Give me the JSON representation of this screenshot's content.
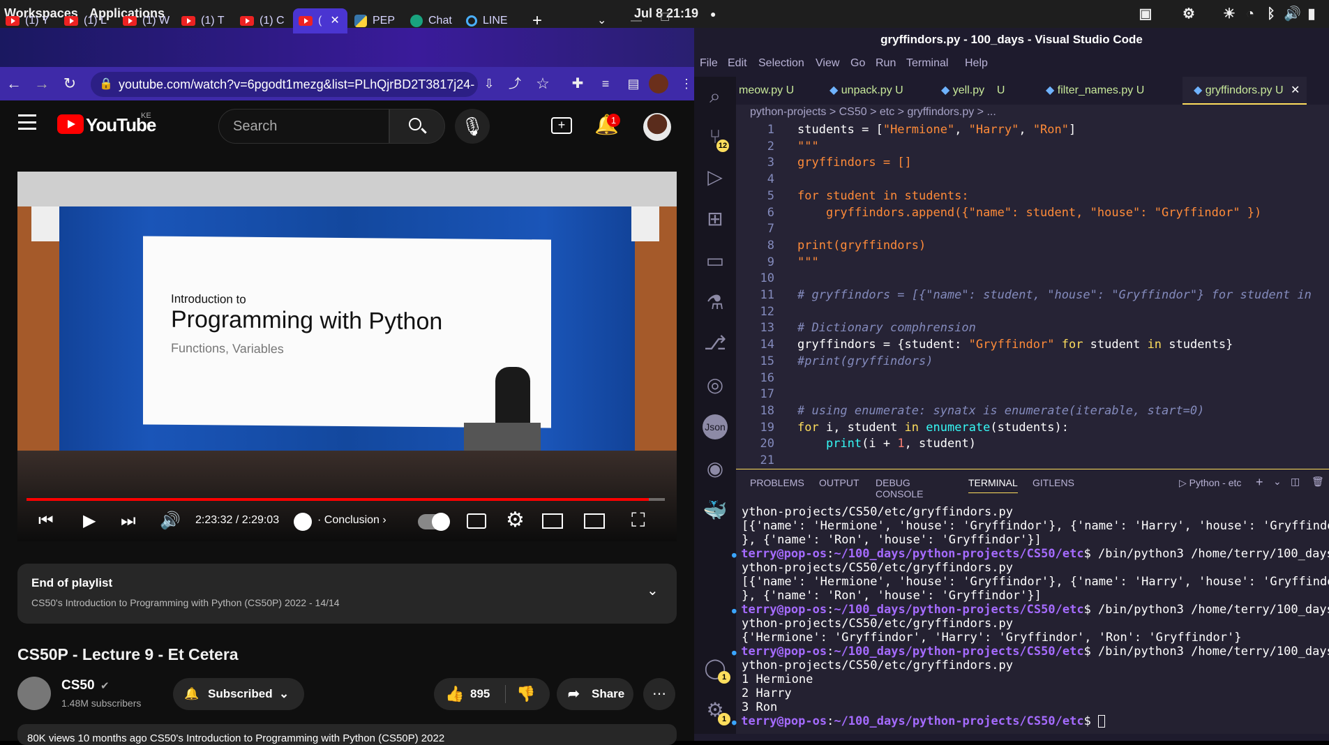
{
  "topbar": {
    "workspaces": "Workspaces",
    "applications": "Applications",
    "date": "Jul 8",
    "time": "21:19"
  },
  "chrome": {
    "tabs": [
      {
        "label": "(1) Y",
        "icon": "youtube-icon"
      },
      {
        "label": "(1) L",
        "icon": "youtube-icon"
      },
      {
        "label": "(1) W",
        "icon": "youtube-icon"
      },
      {
        "label": "(1) T",
        "icon": "youtube-icon"
      },
      {
        "label": "(1) C",
        "icon": "youtube-icon"
      },
      {
        "label": "(",
        "icon": "youtube-icon"
      },
      {
        "label": "PEP",
        "icon": "python-icon"
      },
      {
        "label": "Chat",
        "icon": "chatgpt-icon"
      },
      {
        "label": "LINE",
        "icon": "line-icon"
      }
    ],
    "url": "youtube.com/watch?v=6pgodt1mezg&list=PLhQjrBD2T3817j24-"
  },
  "youtube": {
    "logo": "YouTube",
    "country": "KE",
    "search_placeholder": "Search",
    "notifications": "1",
    "slide": {
      "intro": "Introduction to",
      "title": "Programming with Python",
      "subtitle": "Functions, Variables"
    },
    "progress": 0.975,
    "time": "2:23:32 / 2:29:03",
    "chapter": "Conclusion",
    "playlist": {
      "title": "End of playlist",
      "subtitle": "CS50's Introduction to Programming with Python (CS50P) 2022 - 14/14"
    },
    "video_title": "CS50P - Lecture 9 - Et Cetera",
    "channel": {
      "name": "CS50",
      "subs": "1.48M subscribers",
      "subscribe": "Subscribed"
    },
    "likes": "895",
    "share": "Share",
    "desc": "80K views  10 months ago  CS50's Introduction to Programming with Python (CS50P) 2022"
  },
  "vscode": {
    "title": "gryffindors.py - 100_days - Visual Studio Code",
    "menu": [
      "File",
      "Edit",
      "Selection",
      "View",
      "Go",
      "Run",
      "Terminal",
      "Help"
    ],
    "tabs": [
      {
        "label": "meow.py",
        "status": "U"
      },
      {
        "label": "unpack.py",
        "status": "U"
      },
      {
        "label": "yell.py",
        "status": "U"
      },
      {
        "label": "filter_names.py",
        "status": "U"
      },
      {
        "label": "gryffindors.py",
        "status": "U"
      }
    ],
    "breadcrumb": "python-projects > CS50 > etc > gryffindors.py > ...",
    "scm_badge": "12",
    "account_badge": "1",
    "settings_badge": "1",
    "panel_tabs": [
      "PROBLEMS",
      "OUTPUT",
      "DEBUG CONSOLE",
      "TERMINAL",
      "GITLENS"
    ],
    "terminal_label": "Python - etc",
    "terminal": [
      "ython-projects/CS50/etc/gryffindors.py",
      "[{'name': 'Hermione', 'house': 'Gryffindor'}, {'name': 'Harry', 'house': 'Gryffindo",
      "}, {'name': 'Ron', 'house': 'Gryffindor'}]",
      "terry@pop-os:~/100_days/python-projects/CS50/etc$ /bin/python3 /home/terry/100_days",
      "ython-projects/CS50/etc/gryffindors.py",
      "[{'name': 'Hermione', 'house': 'Gryffindor'}, {'name': 'Harry', 'house': 'Gryffindo",
      "}, {'name': 'Ron', 'house': 'Gryffindor'}]",
      "terry@pop-os:~/100_days/python-projects/CS50/etc$ /bin/python3 /home/terry/100_days",
      "ython-projects/CS50/etc/gryffindors.py",
      "{'Hermione': 'Gryffindor', 'Harry': 'Gryffindor', 'Ron': 'Gryffindor'}",
      "terry@pop-os:~/100_days/python-projects/CS50/etc$ /bin/python3 /home/terry/100_days",
      "ython-projects/CS50/etc/gryffindors.py",
      "1 Hermione",
      "2 Harry",
      "3 Ron",
      "terry@pop-os:~/100_days/python-projects/CS50/etc$ "
    ]
  }
}
